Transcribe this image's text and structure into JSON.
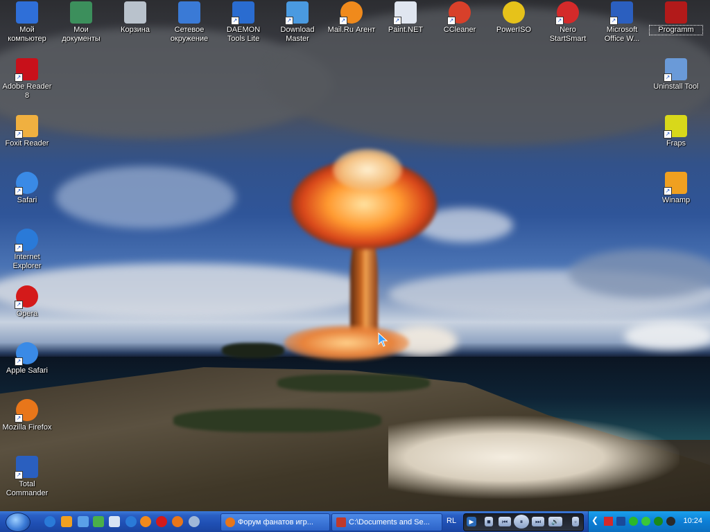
{
  "desktop": {
    "icons_top": [
      {
        "label": "Мой компьютер",
        "icon": "my-computer-icon",
        "color": "#2f6fd8"
      },
      {
        "label": "Мои документы",
        "icon": "my-documents-icon",
        "color": "#3c8f5c"
      },
      {
        "label": "Корзина",
        "icon": "recycle-bin-icon",
        "color": "#b9c2cc"
      },
      {
        "label": "Сетевое окружение",
        "icon": "network-places-icon",
        "color": "#3a7ad6"
      },
      {
        "label": "DAEMON Tools Lite",
        "icon": "daemon-tools-icon",
        "color": "#2a6cd0"
      },
      {
        "label": "Download Master",
        "icon": "download-master-icon",
        "color": "#4a9ae0"
      },
      {
        "label": "Mail.Ru Агент",
        "icon": "mailru-agent-icon",
        "color": "#f08a1c"
      },
      {
        "label": "Paint.NET",
        "icon": "paint-net-icon",
        "color": "#e0e6f0"
      },
      {
        "label": "CCleaner",
        "icon": "ccleaner-icon",
        "color": "#d8402a"
      },
      {
        "label": "PowerISO",
        "icon": "poweriso-icon",
        "color": "#e6c21a"
      },
      {
        "label": "Nero StartSmart",
        "icon": "nero-icon",
        "color": "#d42a2a"
      },
      {
        "label": "Microsoft Office W...",
        "icon": "word-icon",
        "color": "#2b5fbf"
      },
      {
        "label": "Programm",
        "icon": "programm-folder-icon",
        "color": "#b21a1a"
      }
    ],
    "icons_left": [
      {
        "label": "Adobe Reader 8",
        "icon": "adobe-reader-icon",
        "color": "#c8101a"
      },
      {
        "label": "Foxit Reader",
        "icon": "foxit-reader-icon",
        "color": "#f0b040"
      },
      {
        "label": "Safari",
        "icon": "safari-icon",
        "color": "#3a8ae6"
      },
      {
        "label": "Internet Explorer",
        "icon": "internet-explorer-icon",
        "color": "#2a7ad8"
      },
      {
        "label": "Opera",
        "icon": "opera-icon",
        "color": "#d41a1a"
      },
      {
        "label": "Apple Safari",
        "icon": "apple-safari-icon",
        "color": "#3a8ae6"
      },
      {
        "label": "Mozilla Firefox",
        "icon": "firefox-icon",
        "color": "#e8761a"
      },
      {
        "label": "Total Commander",
        "icon": "total-commander-icon",
        "color": "#2a5fbf"
      }
    ],
    "icons_right": [
      {
        "label": "Uninstall Tool",
        "icon": "uninstall-tool-icon",
        "color": "#6a9ad8"
      },
      {
        "label": "Fraps",
        "icon": "fraps-icon",
        "color": "#d8d81a"
      },
      {
        "label": "Winamp",
        "icon": "winamp-icon",
        "color": "#f0a020"
      }
    ]
  },
  "taskbar": {
    "quick_launch": [
      {
        "icon": "ie-quicklaunch-icon",
        "color": "#2a7ad8"
      },
      {
        "icon": "winamp-quicklaunch-icon",
        "color": "#f0a020"
      },
      {
        "icon": "media-player-quicklaunch-icon",
        "color": "#5aa0e8"
      },
      {
        "icon": "messenger-quicklaunch-icon",
        "color": "#4ab04a"
      },
      {
        "icon": "show-desktop-icon",
        "color": "#d8e4f4"
      },
      {
        "icon": "ie2-quicklaunch-icon",
        "color": "#2a7ad8"
      },
      {
        "icon": "mailru-quicklaunch-icon",
        "color": "#f08a1c"
      },
      {
        "icon": "opera-quicklaunch-icon",
        "color": "#d41a1a"
      },
      {
        "icon": "firefox-quicklaunch-icon",
        "color": "#e8761a"
      },
      {
        "icon": "safari-quicklaunch-icon",
        "color": "#a0b8d8"
      }
    ],
    "tasks": [
      {
        "label": "Форум фанатов игр...",
        "icon": "firefox-task-icon",
        "color": "#e8761a"
      },
      {
        "label": "C:\\Documents and Se...",
        "icon": "folder-task-icon",
        "color": "#c0392b"
      }
    ],
    "language": "RL",
    "clock": "10:24"
  }
}
